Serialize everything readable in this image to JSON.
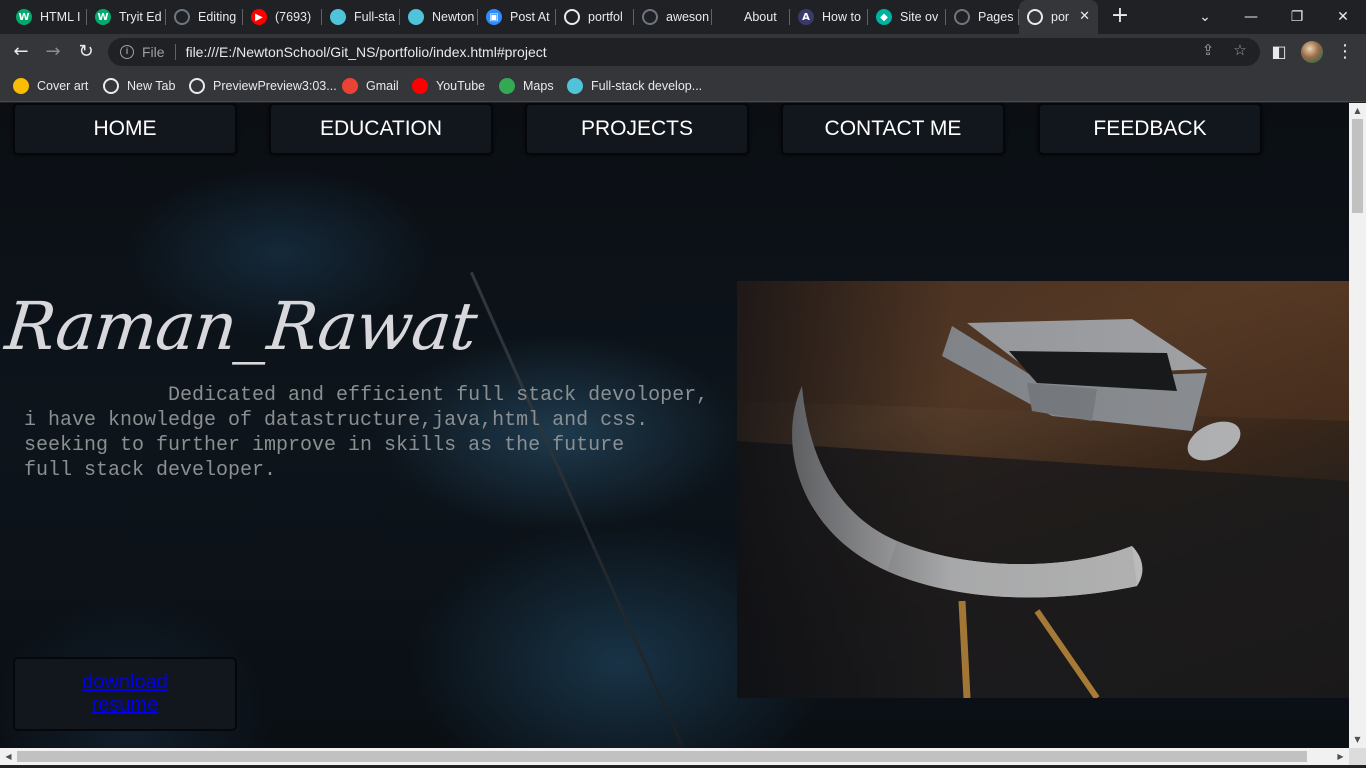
{
  "browser": {
    "tabs": [
      {
        "label": "HTML I",
        "icon": "w3schools-icon",
        "color": "#04aa6d",
        "glyph": "W"
      },
      {
        "label": "Tryit Ed",
        "icon": "w3schools-icon",
        "color": "#04aa6d",
        "glyph": "W"
      },
      {
        "label": "Editing",
        "icon": "github-icon",
        "color": "#444",
        "glyph": ""
      },
      {
        "label": "(7693)",
        "icon": "youtube-icon",
        "color": "#ff0000",
        "glyph": "▶"
      },
      {
        "label": "Full-sta",
        "icon": "newton-icon",
        "color": "#4fc3d9",
        "glyph": ""
      },
      {
        "label": "Newton",
        "icon": "newton-icon",
        "color": "#4fc3d9",
        "glyph": ""
      },
      {
        "label": "Post At",
        "icon": "zoom-icon",
        "color": "#2d8cff",
        "glyph": "▣"
      },
      {
        "label": "portfol",
        "icon": "globe-icon",
        "color": "#e8eaed",
        "glyph": ""
      },
      {
        "label": "aweson",
        "icon": "github-icon",
        "color": "#444",
        "glyph": ""
      },
      {
        "label": "About",
        "icon": "blank-icon",
        "color": "#202124",
        "glyph": ""
      },
      {
        "label": "How to",
        "icon": "angular-icon",
        "color": "#3a3a6a",
        "glyph": "A"
      },
      {
        "label": "Site ov",
        "icon": "diamond-icon",
        "color": "#00b3a0",
        "glyph": "◆"
      },
      {
        "label": "Pages",
        "icon": "github-icon",
        "color": "#444",
        "glyph": ""
      },
      {
        "label": "por",
        "icon": "globe-icon",
        "color": "#e8eaed",
        "glyph": "",
        "active": true
      }
    ],
    "close_tab_glyph": "✕",
    "new_tab_glyph": "+",
    "window_controls": {
      "tab_search": "⌄",
      "minimize": "—",
      "restore": "❐",
      "close": "✕"
    },
    "nav": {
      "back": "←",
      "forward": "→",
      "reload": "↻"
    },
    "address": {
      "scheme_label": "File",
      "url": "file:///E:/NewtonSchool/Git_NS/portfolio/index.html#project"
    },
    "toolbar_icons": {
      "share": "⇪",
      "star": "☆",
      "sidepanel": "◧",
      "menu": "⋮"
    },
    "bookmarks": [
      {
        "label": "Cover art",
        "icon": "photos-icon",
        "color": "#fbbc05"
      },
      {
        "label": "New Tab",
        "icon": "globe-icon",
        "color": "#e8eaed"
      },
      {
        "label": "PreviewPreview3:03...",
        "icon": "globe-icon",
        "color": "#e8eaed"
      },
      {
        "label": "Gmail",
        "icon": "gmail-icon",
        "color": "#ea4335"
      },
      {
        "label": "YouTube",
        "icon": "youtube-icon",
        "color": "#ff0000"
      },
      {
        "label": "Maps",
        "icon": "maps-icon",
        "color": "#34a853"
      },
      {
        "label": "Full-stack develop...",
        "icon": "newton-icon",
        "color": "#4fc3d9"
      }
    ]
  },
  "page": {
    "nav": [
      "HOME",
      "EDUCATION",
      "PROJECTS",
      "CONTACT ME",
      "FEEDBACK"
    ],
    "name": "Raman_Rawat",
    "bio": "            Dedicated and efficient full stack devoloper,\ni have knowledge of datastructure,java,html and css.\nseeking to further improve in skills as the future\nfull stack developer.",
    "resume_link": "download resume"
  }
}
